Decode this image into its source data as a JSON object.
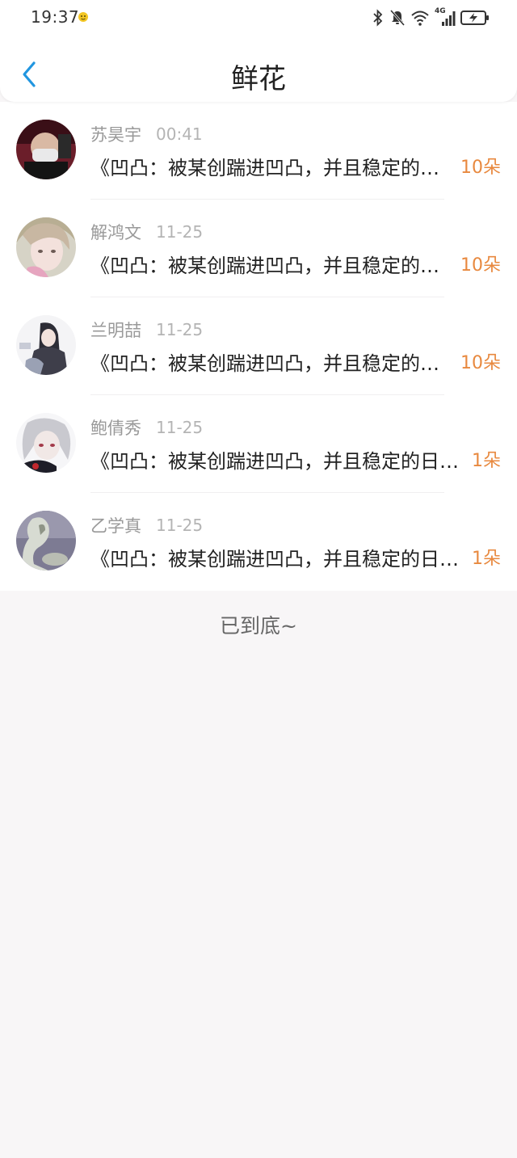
{
  "status": {
    "time": "19:37",
    "network": "4G"
  },
  "header": {
    "title": "鲜花"
  },
  "items": [
    {
      "name": "苏昊宇",
      "time": "00:41",
      "message": "《凹凸：被某创踹进凹凸，并且稳定的日常》",
      "count": "10朵"
    },
    {
      "name": "解鸿文",
      "time": "11-25",
      "message": "《凹凸：被某创踹进凹凸，并且稳定的日常》",
      "count": "10朵"
    },
    {
      "name": "兰明喆",
      "time": "11-25",
      "message": "《凹凸：被某创踹进凹凸，并且稳定的日常》",
      "count": "10朵"
    },
    {
      "name": "鲍倩秀",
      "time": "11-25",
      "message": "《凹凸：被某创踹进凹凸，并且稳定的日常》",
      "count": "1朵"
    },
    {
      "name": "乙学真",
      "time": "11-25",
      "message": "《凹凸：被某创踹进凹凸，并且稳定的日常》",
      "count": "1朵"
    }
  ],
  "footer": {
    "end_text": "已到底~"
  },
  "colors": {
    "accent": "#2196e0",
    "count": "#e8893f"
  }
}
